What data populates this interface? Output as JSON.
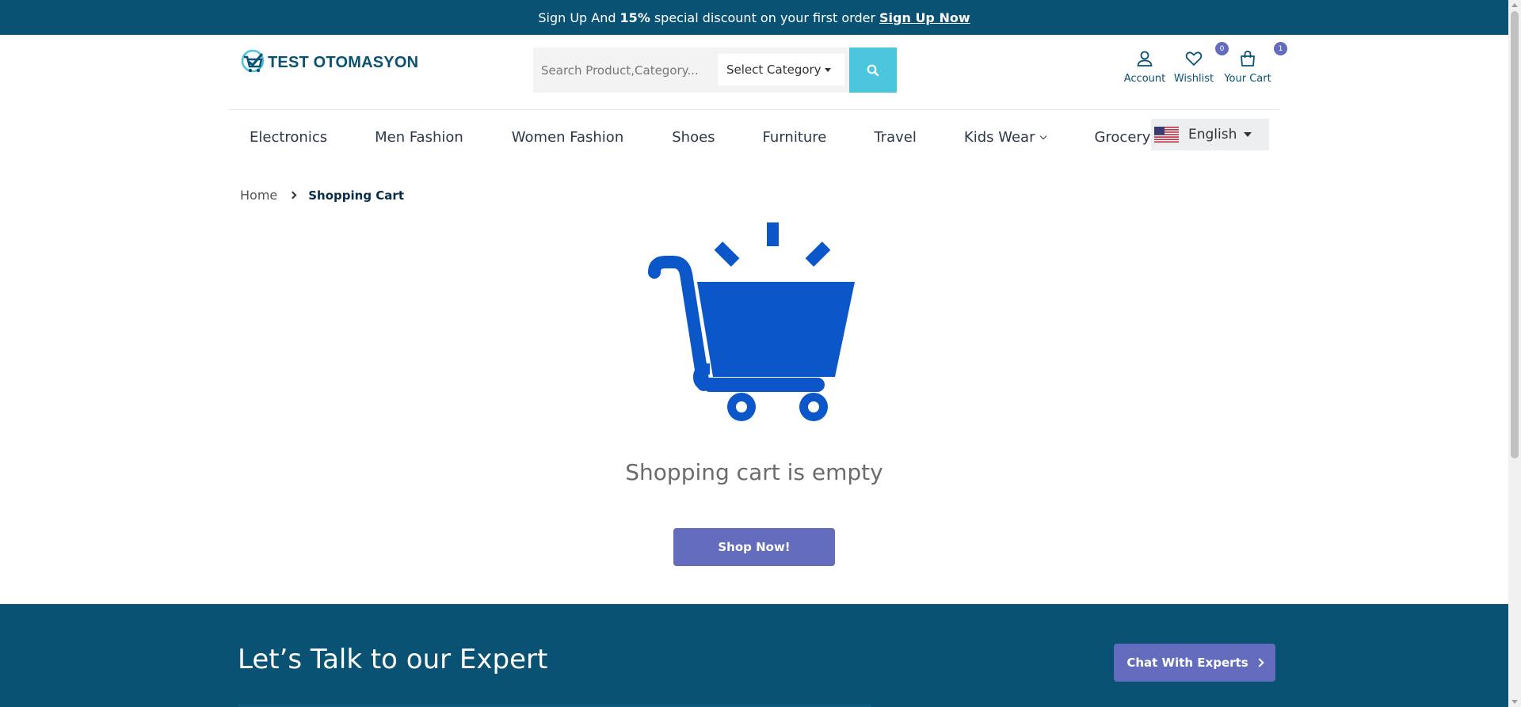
{
  "promo": {
    "prefix": "Sign Up And",
    "highlight": "15%",
    "suffix": "special discount on your first order",
    "link": "Sign Up Now"
  },
  "logo": {
    "text": "TEST OTOMASYON"
  },
  "search": {
    "placeholder": "Search Product,Category...",
    "category_label": "Select Category",
    "search_icon": "search-icon"
  },
  "header_actions": {
    "account_label": "Account",
    "wishlist_label": "Wishlist",
    "wishlist_count": "0",
    "cart_label": "Your Cart",
    "cart_count": "1"
  },
  "nav": {
    "items": [
      {
        "label": "Electronics"
      },
      {
        "label": "Men Fashion"
      },
      {
        "label": "Women Fashion"
      },
      {
        "label": "Shoes"
      },
      {
        "label": "Furniture"
      },
      {
        "label": "Travel"
      },
      {
        "label": "Kids Wear"
      },
      {
        "label": "Grocery"
      }
    ]
  },
  "language": {
    "label": "English",
    "flag": "us-flag-icon"
  },
  "breadcrumb": {
    "home": "Home",
    "current": "Shopping Cart"
  },
  "cart": {
    "empty_message": "Shopping cart is empty",
    "shop_button": "Shop Now!"
  },
  "footer_cta": {
    "title": "Let’s Talk to our Expert",
    "chat_button": "Chat With Experts"
  },
  "colors": {
    "primary_dark": "#0a5273",
    "accent_purple": "#646cbe",
    "search_button": "#4cc6dc",
    "cart_icon_blue": "#0b57c9"
  }
}
